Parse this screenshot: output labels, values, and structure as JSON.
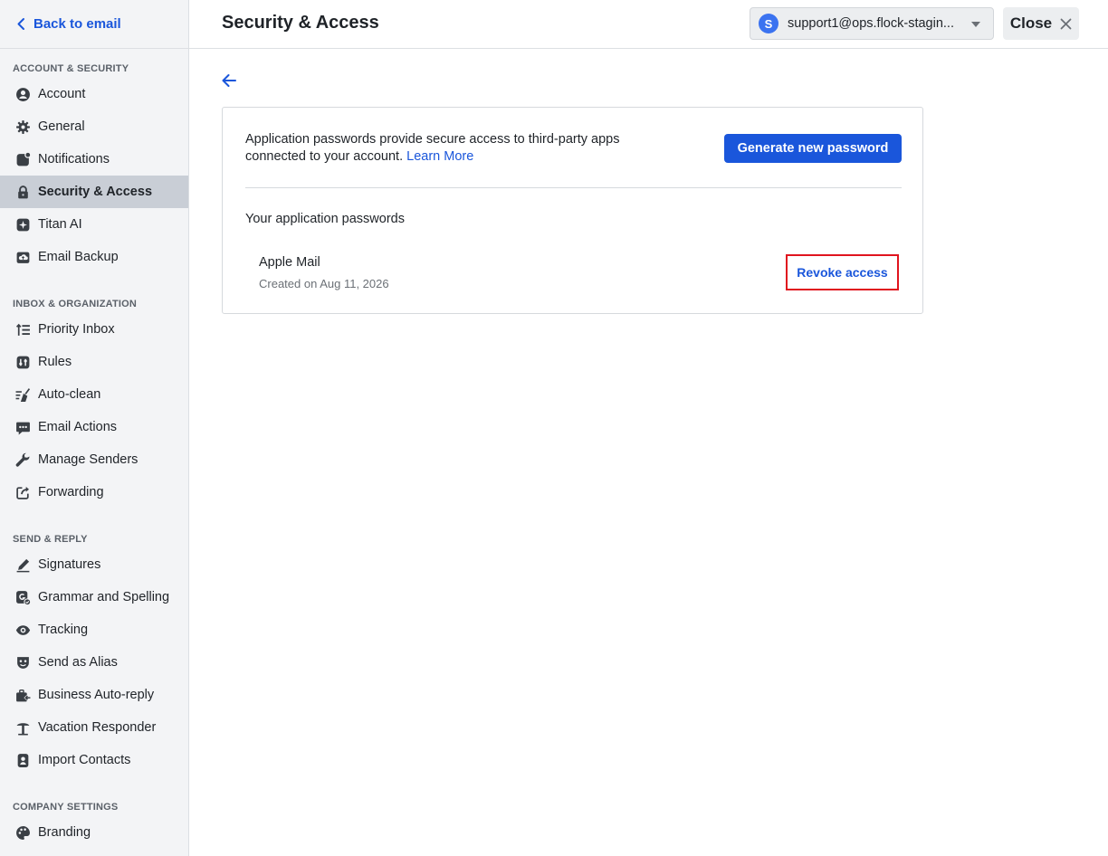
{
  "sidebar": {
    "back_label": "Back to email",
    "sections": [
      {
        "title": "ACCOUNT & SECURITY",
        "items": [
          {
            "label": "Account",
            "icon": "user-circle-icon"
          },
          {
            "label": "General",
            "icon": "gear-icon"
          },
          {
            "label": "Notifications",
            "icon": "notification-icon"
          },
          {
            "label": "Security & Access",
            "icon": "lock-icon",
            "active": true
          },
          {
            "label": "Titan AI",
            "icon": "sparkle-icon"
          },
          {
            "label": "Email Backup",
            "icon": "cloud-upload-icon"
          }
        ]
      },
      {
        "title": "INBOX & ORGANIZATION",
        "items": [
          {
            "label": "Priority Inbox",
            "icon": "priority-sort-icon"
          },
          {
            "label": "Rules",
            "icon": "rules-icon"
          },
          {
            "label": "Auto-clean",
            "icon": "broom-icon"
          },
          {
            "label": "Email Actions",
            "icon": "chat-actions-icon"
          },
          {
            "label": "Manage Senders",
            "icon": "wrench-icon"
          },
          {
            "label": "Forwarding",
            "icon": "forward-icon"
          }
        ]
      },
      {
        "title": "SEND & REPLY",
        "items": [
          {
            "label": "Signatures",
            "icon": "pen-icon"
          },
          {
            "label": "Grammar and Spelling",
            "icon": "grammar-check-icon"
          },
          {
            "label": "Tracking",
            "icon": "eye-icon"
          },
          {
            "label": "Send as Alias",
            "icon": "alias-mask-icon"
          },
          {
            "label": "Business Auto-reply",
            "icon": "auto-reply-icon"
          },
          {
            "label": "Vacation Responder",
            "icon": "palm-tree-icon"
          },
          {
            "label": "Import Contacts",
            "icon": "contacts-icon"
          }
        ]
      },
      {
        "title": "COMPANY SETTINGS",
        "items": [
          {
            "label": "Branding",
            "icon": "palette-icon"
          }
        ]
      }
    ]
  },
  "header": {
    "title": "Security & Access",
    "account": {
      "initial": "S",
      "email": "support1@ops.flock-stagin..."
    },
    "close_label": "Close"
  },
  "main": {
    "intro_text": "Application passwords provide secure access to third-party apps connected to your account.",
    "learn_more_label": "Learn More",
    "generate_button_label": "Generate new password",
    "passwords_heading": "Your application passwords",
    "passwords": [
      {
        "name": "Apple Mail",
        "created": "Created on Aug 11, 2026",
        "revoke_label": "Revoke access"
      }
    ]
  },
  "colors": {
    "accent": "#1a56db",
    "highlight_border": "#e0141e",
    "sidebar_bg": "#f3f4f6",
    "sidebar_active_bg": "#c9ced6"
  }
}
